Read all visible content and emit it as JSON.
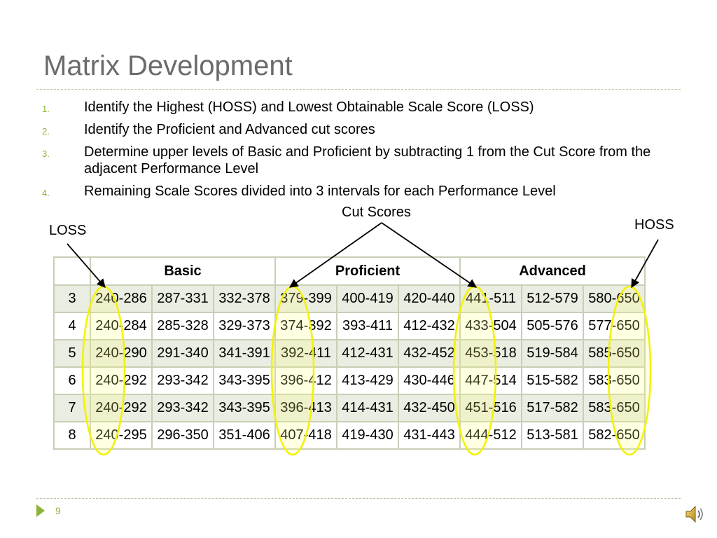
{
  "slide": {
    "title": "Matrix Development",
    "page_number": "9"
  },
  "steps": [
    {
      "num": "1.",
      "text": "Identify the Highest (HOSS) and Lowest Obtainable Scale Score (LOSS)"
    },
    {
      "num": "2.",
      "text": "Identify the Proficient and Advanced cut scores"
    },
    {
      "num": "3.",
      "text": "Determine upper levels of Basic and Proficient by subtracting 1 from the Cut Score from the adjacent Performance Level"
    },
    {
      "num": "4.",
      "text": "Remaining Scale Scores divided into 3 intervals for each Performance Level"
    }
  ],
  "callouts": {
    "loss": "LOSS",
    "cut_scores": "Cut Scores",
    "hoss": "HOSS"
  },
  "table": {
    "headers": [
      "",
      "Basic",
      "Proficient",
      "Advanced"
    ],
    "rows": [
      {
        "grade": "3",
        "ranges": [
          "240-286",
          "287-331",
          "332-378",
          "379-399",
          "400-419",
          "420-440",
          "441-511",
          "512-579",
          "580-650"
        ]
      },
      {
        "grade": "4",
        "ranges": [
          "240-284",
          "285-328",
          "329-373",
          "374-392",
          "393-411",
          "412-432",
          "433-504",
          "505-576",
          "577-650"
        ]
      },
      {
        "grade": "5",
        "ranges": [
          "240-290",
          "291-340",
          "341-391",
          "392-411",
          "412-431",
          "432-452",
          "453-518",
          "519-584",
          "585-650"
        ]
      },
      {
        "grade": "6",
        "ranges": [
          "240-292",
          "293-342",
          "343-395",
          "396-412",
          "413-429",
          "430-446",
          "447-514",
          "515-582",
          "583-650"
        ]
      },
      {
        "grade": "7",
        "ranges": [
          "240-292",
          "293-342",
          "343-395",
          "396-413",
          "414-431",
          "432-450",
          "451-516",
          "517-582",
          "583-650"
        ]
      },
      {
        "grade": "8",
        "ranges": [
          "240-295",
          "296-350",
          "351-406",
          "407-418",
          "419-430",
          "431-443",
          "444-512",
          "513-581",
          "582-650"
        ]
      }
    ]
  },
  "colors": {
    "accent": "#8db33a",
    "highlight": "#f2f200",
    "title": "#6b6b6b",
    "shaded_row": "#eaeee2"
  },
  "icons": {
    "page_marker": "triangle-right-icon",
    "audio": "speaker-icon"
  }
}
